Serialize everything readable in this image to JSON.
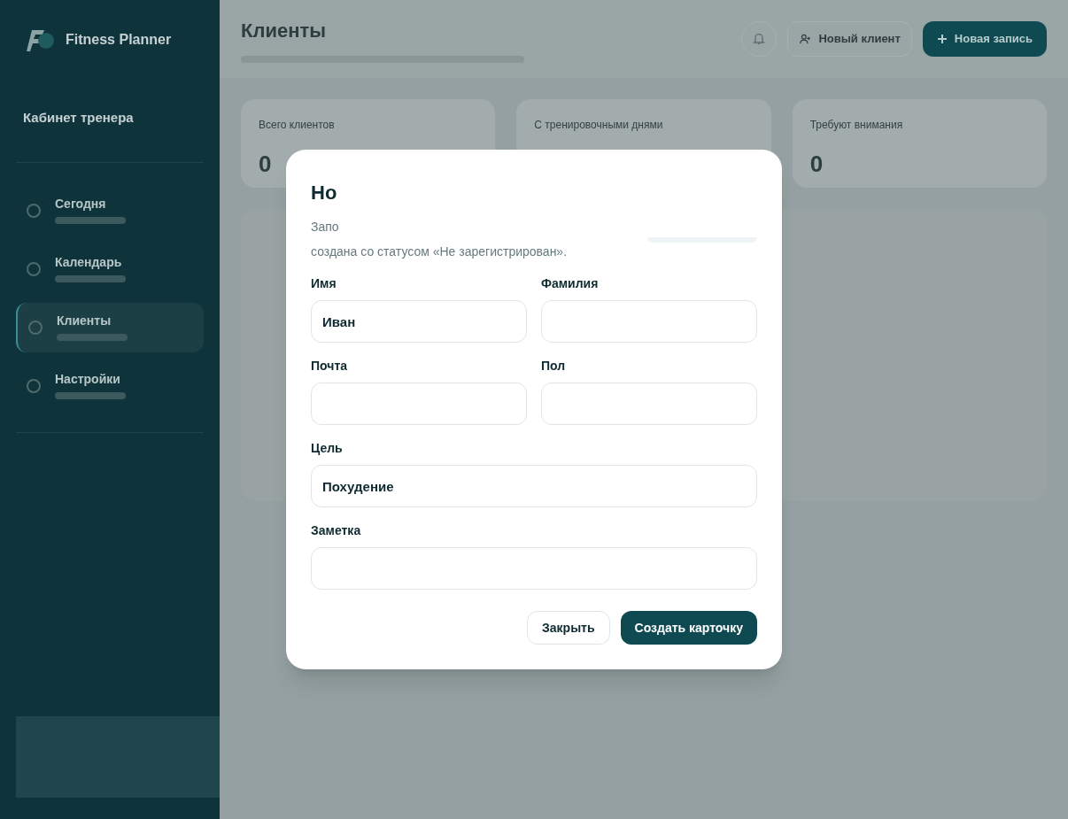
{
  "sidebar": {
    "brand": "Fitness Planner",
    "section_title": "Кабинет тренера",
    "items": [
      {
        "label": "Сегодня",
        "selected": false
      },
      {
        "label": "Календарь",
        "selected": false
      },
      {
        "label": "Клиенты",
        "selected": true
      },
      {
        "label": "Настройки",
        "selected": false
      }
    ]
  },
  "header": {
    "title": "Клиенты",
    "buttons": [
      "Новый клиент",
      "Новая запись"
    ]
  },
  "stats": [
    {
      "label": "Всего клиентов",
      "value": "0"
    },
    {
      "label": "С тренировочными днями"
    },
    {
      "label": "Требуют внимания",
      "value": "0"
    }
  ],
  "dialog": {
    "title": "Но",
    "description_lines": [
      "Запо",
      "создана со статусом «Не зарегистрирован»."
    ],
    "field_rows": [
      [
        {
          "label": "Имя",
          "value": "Иван"
        },
        {
          "label": "Фамилия"
        }
      ],
      [
        {
          "label": "Почта"
        },
        {
          "label": "Пол"
        }
      ],
      [
        {
          "label": "Цель",
          "value": "Похудение"
        }
      ],
      [
        {
          "label": "Заметка"
        }
      ]
    ],
    "buttons": [
      {
        "label": "Закрыть",
        "kind": "secondary"
      },
      {
        "label": "Создать карточку",
        "kind": "primary"
      }
    ]
  }
}
